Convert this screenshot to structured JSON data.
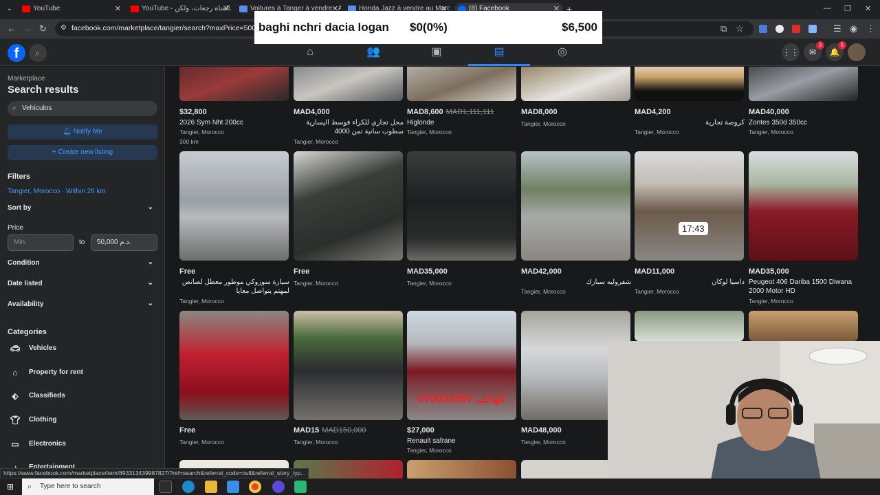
{
  "browser": {
    "tabs": [
      {
        "label": "YouTube",
        "color": "#ff0000"
      },
      {
        "label": "YouTube - القناة رجعات، ولكن...",
        "color": "#ff0000"
      },
      {
        "label": "Voitures à Tanger à vendre - A...",
        "color": "#5a8dee"
      },
      {
        "label": "Honda Jazz à vendre au Maroc...",
        "color": "#5a8dee"
      },
      {
        "label": "(8) Facebook",
        "color": "#0866ff"
      }
    ],
    "url": "facebook.com/marketplace/tangier/search?maxPrice=50000&q",
    "new_tab": "+"
  },
  "overlay": {
    "query": "baghi nchri dacia logan",
    "stat": "$0(0%)",
    "amount": "$6,500"
  },
  "header": {
    "logo": "f",
    "messenger_badge": "3",
    "notifications_badge": "5",
    "nav": [
      "home-icon",
      "friends-icon",
      "video-icon",
      "marketplace-icon",
      "groups-icon"
    ],
    "active_nav": "marketplace-icon"
  },
  "sidebar": {
    "section": "Marketplace",
    "title": "Search results",
    "search_value": "Vehículos",
    "notify_label": "Notify Me",
    "create_label": "Create new listing",
    "filters_heading": "Filters",
    "location": "Tangier, Morocco · Within 26 km",
    "sort_by": "Sort by",
    "price_heading": "Price",
    "price_min_placeholder": "Min.",
    "price_to": "to",
    "price_max_value": "50,000 د.م.",
    "condition": "Condition",
    "date_listed": "Date listed",
    "availability": "Availability",
    "categories_heading": "Categories",
    "categories": [
      {
        "label": "Vehicles",
        "icon": "car-icon"
      },
      {
        "label": "Property for rent",
        "icon": "house-icon"
      },
      {
        "label": "Classifieds",
        "icon": "tag-icon"
      },
      {
        "label": "Clothing",
        "icon": "shirt-icon"
      },
      {
        "label": "Electronics",
        "icon": "laptop-icon"
      },
      {
        "label": "Entertainment",
        "icon": "music-icon"
      }
    ]
  },
  "listings_row1": [
    {
      "price": "$32,800",
      "old_price": "",
      "title": "2026 Sym Nht 200cc",
      "location": "Tangier, Morocco",
      "km": "300 km",
      "rtl": false
    },
    {
      "price": "MAD4,000",
      "old_price": "",
      "title": "محل تجاري للكراء فوسط اليسارية سطوب سانية تمن 4000",
      "location": "Tangier, Morocco",
      "km": "",
      "rtl": true
    },
    {
      "price": "MAD8,600",
      "old_price": "MAD1,111,111",
      "title": "Higlonde",
      "location": "Tangier, Morocco",
      "km": "",
      "rtl": false
    },
    {
      "price": "MAD8,000",
      "old_price": "",
      "title": "",
      "location": "Tangier, Morocco",
      "km": "",
      "rtl": false
    },
    {
      "price": "MAD4,200",
      "old_price": "",
      "title": "كروصة تجارية",
      "location": "Tangier, Morocco",
      "km": "",
      "rtl": true
    },
    {
      "price": "MAD40,000",
      "old_price": "",
      "title": "Zontes 350d 350cc",
      "location": "Tangier, Morocco",
      "km": "",
      "rtl": false
    }
  ],
  "listings_row2": [
    {
      "price": "Free",
      "old_price": "",
      "title": "سيارة سوزوكي موطور معطل لصانص لمهتم يتواصل معايا",
      "location": "Tangier, Morocco",
      "rtl": true
    },
    {
      "price": "Free",
      "old_price": "",
      "title": "",
      "location": "Tangier, Morocco",
      "rtl": false
    },
    {
      "price": "MAD35,000",
      "old_price": "",
      "title": "",
      "location": "Tangier, Morocco",
      "rtl": false
    },
    {
      "price": "MAD42,000",
      "old_price": "",
      "title": "شفروليه سبارك",
      "location": "Tangier, Morocco",
      "rtl": true
    },
    {
      "price": "MAD11,000",
      "old_price": "",
      "title": "داسيا لوكان",
      "location": "Tangier, Morocco",
      "rtl": true,
      "duration": "17:43"
    },
    {
      "price": "MAD35,000",
      "old_price": "",
      "title": "Peugeot 406 Dariba 1500 Diwana 2000 Motor HD",
      "location": "Tangier, Morocco",
      "rtl": false
    }
  ],
  "listings_row3": [
    {
      "price": "Free",
      "old_price": "",
      "title": "",
      "location": "Tangier, Morocco"
    },
    {
      "price": "MAD15",
      "old_price": "MAD150,000",
      "title": "",
      "location": "Tangier, Morocco"
    },
    {
      "price": "$27,000",
      "old_price": "",
      "title": "Renault safrane",
      "location": "Tangier, Morocco",
      "image_text": "070033597 الهاتف"
    },
    {
      "price": "MAD48,000",
      "old_price": "",
      "title": "",
      "location": "Tangier, Morocco"
    }
  ],
  "status_url": "https://www.facebook.com/marketplace/item/893313439987827/?ref=search&referral_code=null&referral_story_typ...",
  "taskbar": {
    "search_placeholder": "Type here to search"
  }
}
